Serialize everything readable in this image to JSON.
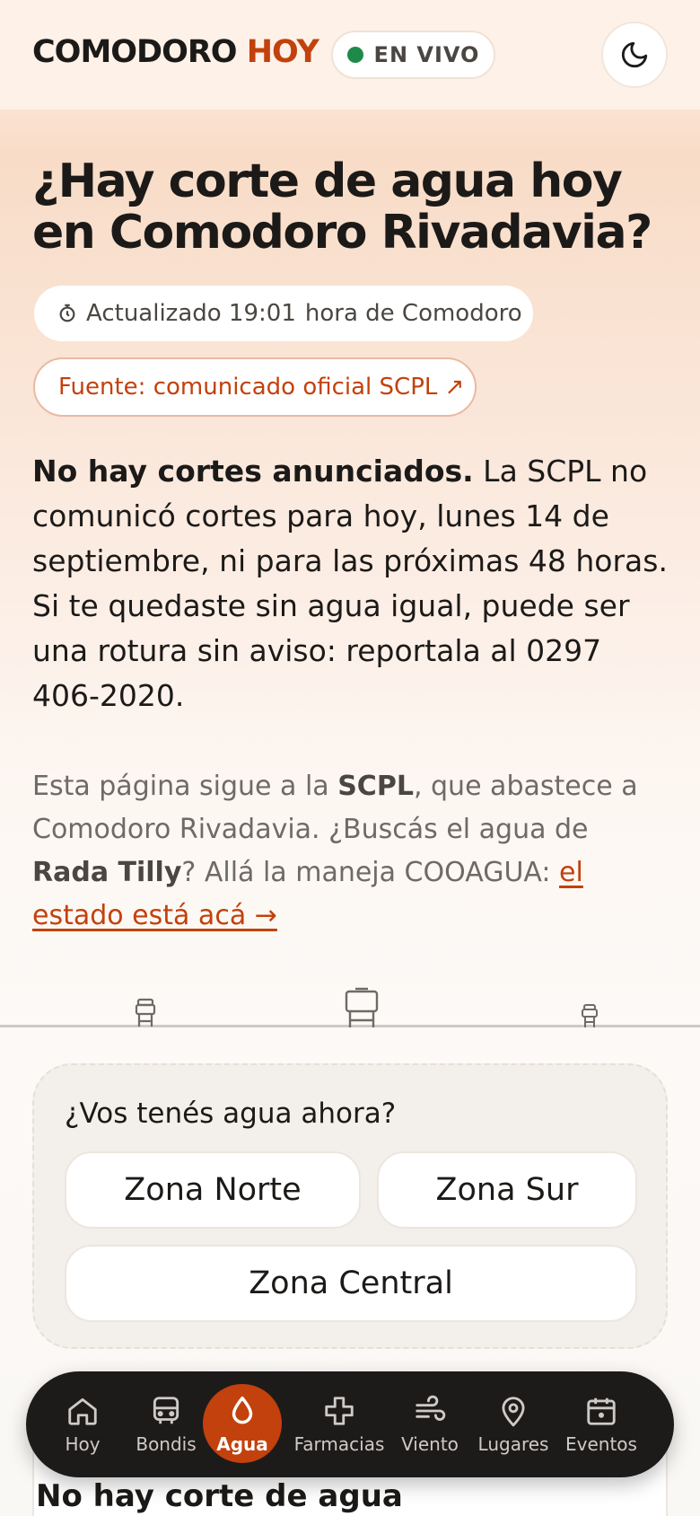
{
  "header": {
    "logo_main": "COMODORO",
    "logo_accent": "HOY",
    "live_label": "EN VIVO"
  },
  "hero": {
    "title_line1": "¿Hay corte de agua hoy",
    "title_line2": "en Comodoro Rivadavia?",
    "updated_label": "Actualizado 19:01",
    "updated_suffix": "hora de Comodoro",
    "source_label": "Fuente: comunicado oficial SCPL ↗"
  },
  "status": {
    "headline": "No hay cortes anunciados.",
    "body": " La SCPL no comunicó cortes para hoy, lunes 14 de septiembre, ni para las próximas 48 horas. Si te quedaste sin agua igual, puede ser una rotura sin aviso: reportala al 0297 406-2020."
  },
  "info": {
    "part1": "Esta página sigue a la ",
    "bold1": "SCPL",
    "part2": ", que abastece a Comodoro Rivadavia. ¿Buscás el agua de ",
    "bold2": "Rada Tilly",
    "part3": "? Allá la maneja COOAGUA: ",
    "link": "el estado está acá →"
  },
  "survey": {
    "question": "¿Vos tenés agua ahora?",
    "zones": [
      "Zona Norte",
      "Zona Sur",
      "Zona Central"
    ]
  },
  "card_below": {
    "title": "No hay corte de agua"
  },
  "nav": {
    "items": [
      {
        "label": "Hoy",
        "icon": "home-icon"
      },
      {
        "label": "Bondis",
        "icon": "bus-icon"
      },
      {
        "label": "Agua",
        "icon": "water-drop-icon",
        "active": true
      },
      {
        "label": "Farmacias",
        "icon": "pharmacy-cross-icon"
      },
      {
        "label": "Viento",
        "icon": "wind-icon"
      },
      {
        "label": "Lugares",
        "icon": "map-pin-icon"
      },
      {
        "label": "Eventos",
        "icon": "calendar-icon"
      }
    ]
  },
  "colors": {
    "accent": "#c2410c",
    "live": "#1e8a4a",
    "nav_bg": "#1d1b1a"
  }
}
